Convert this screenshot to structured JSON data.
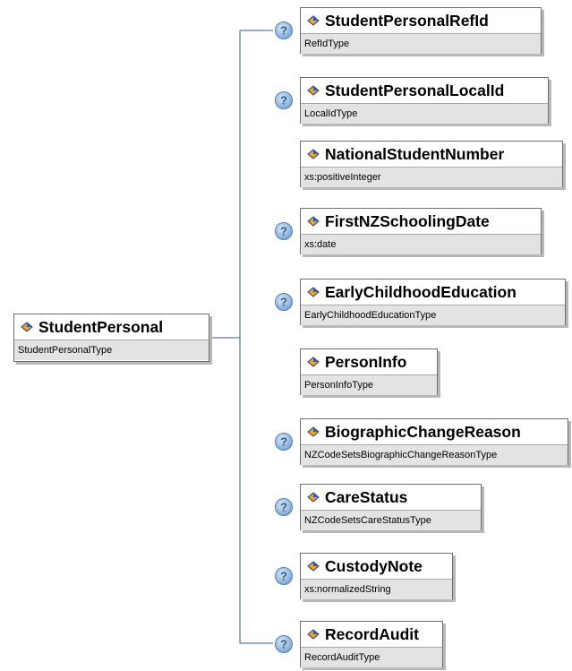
{
  "root": {
    "name": "StudentPersonal",
    "type": "StudentPersonalType"
  },
  "children": [
    {
      "name": "StudentPersonalRefId",
      "type": "RefIdType",
      "optional": true
    },
    {
      "name": "StudentPersonalLocalId",
      "type": "LocalIdType",
      "optional": true
    },
    {
      "name": "NationalStudentNumber",
      "type": "xs:positiveInteger",
      "optional": false
    },
    {
      "name": "FirstNZSchoolingDate",
      "type": "xs:date",
      "optional": true
    },
    {
      "name": "EarlyChildhoodEducation",
      "type": "EarlyChildhoodEducationType",
      "optional": true
    },
    {
      "name": "PersonInfo",
      "type": "PersonInfoType",
      "optional": false
    },
    {
      "name": "BiographicChangeReason",
      "type": "NZCodeSetsBiographicChangeReasonType",
      "optional": true
    },
    {
      "name": "CareStatus",
      "type": "NZCodeSetsCareStatusType",
      "optional": true
    },
    {
      "name": "CustodyNote",
      "type": "xs:normalizedString",
      "optional": true
    },
    {
      "name": "RecordAudit",
      "type": "RecordAuditType",
      "optional": true
    }
  ],
  "icons": {
    "element": "element-diamond-icon",
    "optional": "question-mark-icon"
  },
  "colors": {
    "connector": "#2f5a8a",
    "optional_badge": "#4f81bd",
    "type_band": "#e3e3e3"
  }
}
